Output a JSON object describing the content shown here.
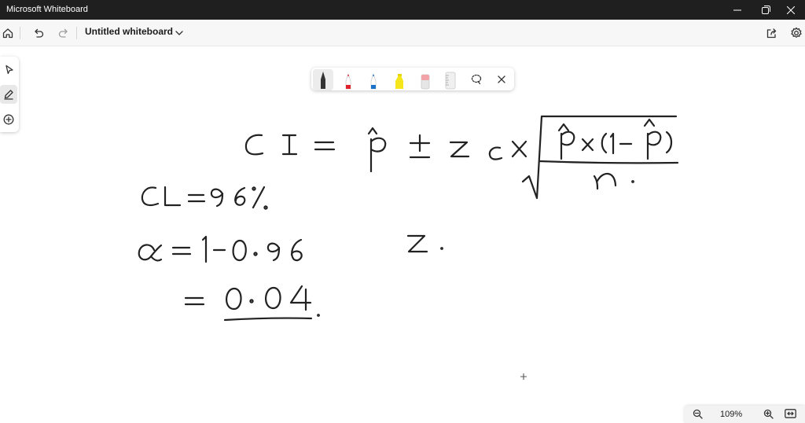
{
  "window": {
    "title": "Microsoft Whiteboard"
  },
  "appbar": {
    "board_title": "Untitled whiteboard"
  },
  "icons": {
    "home": "home-icon",
    "undo": "undo-icon",
    "redo": "redo-icon",
    "chevron": "chevron-down-icon",
    "share": "share-icon",
    "settings": "gear-icon",
    "select": "select-pointer-icon",
    "ink": "pen-icon",
    "add": "add-icon",
    "lasso": "lasso-icon",
    "close": "close-icon",
    "zoom_out": "zoom-out-icon",
    "zoom_in": "zoom-in-icon",
    "fit": "fit-to-screen-icon"
  },
  "pens": [
    {
      "name": "black-pen",
      "color": "#222222",
      "selected": true
    },
    {
      "name": "red-pen",
      "color": "#e0242f",
      "selected": false
    },
    {
      "name": "blue-pen",
      "color": "#1a73c9",
      "selected": false
    },
    {
      "name": "yellow-highlighter",
      "color": "#f5e51b",
      "selected": false
    },
    {
      "name": "eraser",
      "color": "#f2a3a8",
      "selected": false
    },
    {
      "name": "ruler",
      "color": "#c9c9c9",
      "selected": false
    }
  ],
  "zoom": {
    "level": "109%"
  }
}
